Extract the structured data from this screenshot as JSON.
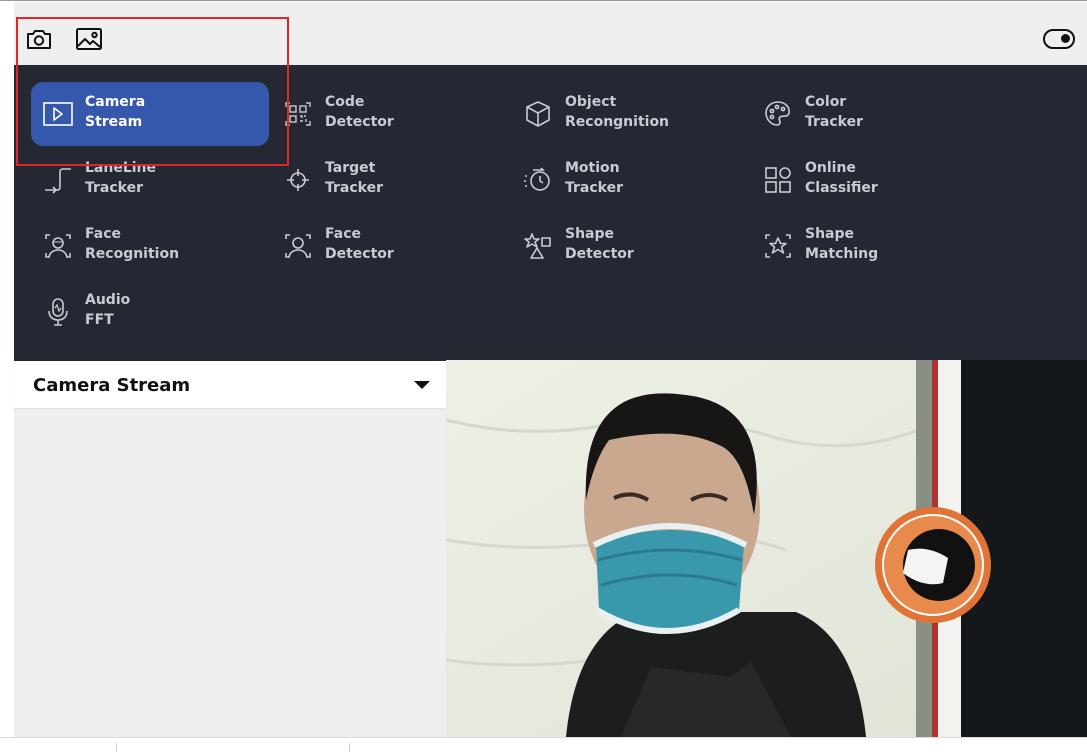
{
  "toolbar": {
    "icons": [
      "camera-icon",
      "image-icon"
    ],
    "toggle_icon": "toggle-icon"
  },
  "menu": {
    "items": [
      {
        "label": "Camera\nStream",
        "icon": "play-square-icon",
        "active": true
      },
      {
        "label": "Code\nDetector",
        "icon": "qr-code-icon"
      },
      {
        "label": "Object\nRecongnition",
        "icon": "cube-icon"
      },
      {
        "label": "Color\nTracker",
        "icon": "palette-icon"
      },
      {
        "label": "LaneLine\nTracker",
        "icon": "laneline-icon"
      },
      {
        "label": "Target\nTracker",
        "icon": "crosshair-icon"
      },
      {
        "label": "Motion\nTracker",
        "icon": "motion-icon"
      },
      {
        "label": "Online\nClassifier",
        "icon": "grid-icon"
      },
      {
        "label": "Face\nRecognition",
        "icon": "face-scan-icon"
      },
      {
        "label": "Face\nDetector",
        "icon": "face-detect-icon"
      },
      {
        "label": "Shape\nDetector",
        "icon": "shapes-icon"
      },
      {
        "label": "Shape\nMatching",
        "icon": "star-frame-icon"
      },
      {
        "label": "Audio\nFFT",
        "icon": "microphone-icon"
      }
    ]
  },
  "panel": {
    "dropdown_label": "Camera Stream"
  },
  "colors": {
    "menu_bg": "#232832",
    "active_bg": "#3558ad",
    "highlight": "#e0252b"
  }
}
